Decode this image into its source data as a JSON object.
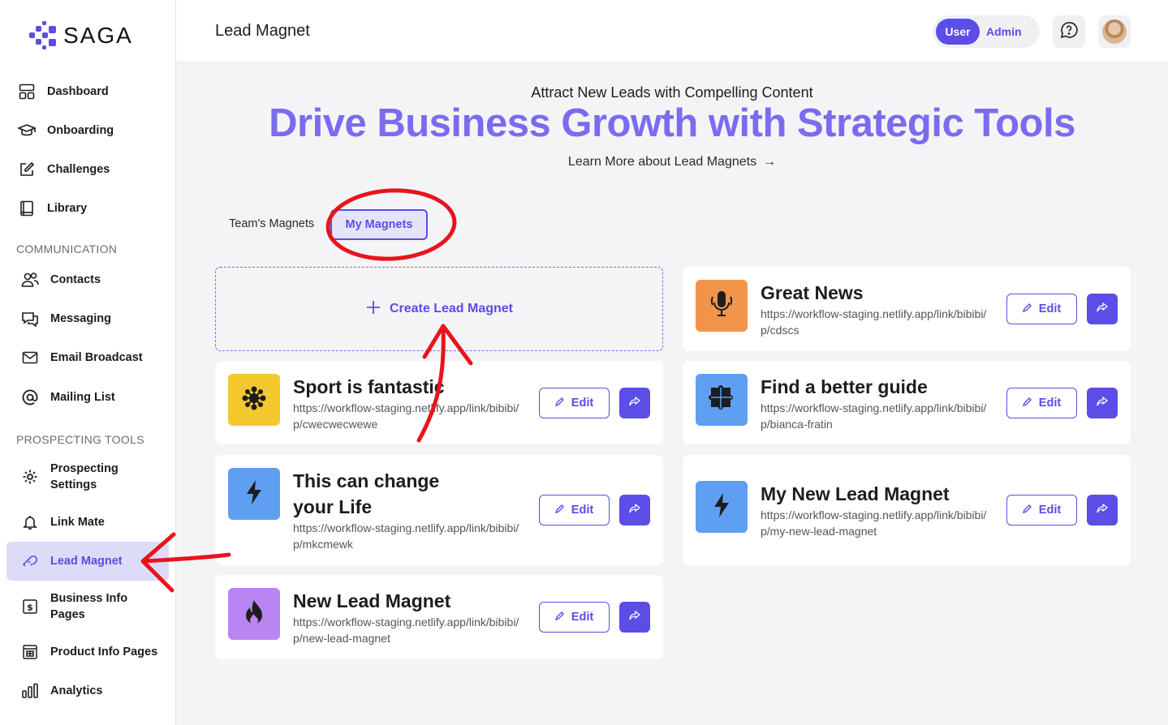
{
  "brand": {
    "name": "SAGA"
  },
  "sidebar": {
    "items": [
      {
        "label": "Dashboard",
        "icon": "dashboard-icon"
      },
      {
        "label": "Onboarding",
        "icon": "graduation-cap-icon"
      },
      {
        "label": "Challenges",
        "icon": "edit-square-icon"
      },
      {
        "label": "Library",
        "icon": "book-icon"
      }
    ],
    "communication_label": "COMMUNICATION",
    "communication": [
      {
        "label": "Contacts",
        "icon": "users-icon"
      },
      {
        "label": "Messaging",
        "icon": "chat-icon"
      },
      {
        "label": "Email Broadcast",
        "icon": "mail-icon"
      },
      {
        "label": "Mailing List",
        "icon": "at-icon"
      }
    ],
    "prospecting_label": "PROSPECTING TOOLS",
    "prospecting": [
      {
        "label": "Prospecting Settings",
        "icon": "gear-icon"
      },
      {
        "label": "Link Mate",
        "icon": "bell-icon"
      },
      {
        "label": "Lead Magnet",
        "icon": "magnet-icon",
        "active": true
      },
      {
        "label": "Business Info Pages",
        "icon": "dollar-doc-icon"
      },
      {
        "label": "Product Info Pages",
        "icon": "grid-doc-icon"
      },
      {
        "label": "Analytics",
        "icon": "bar-chart-icon"
      }
    ]
  },
  "header": {
    "title": "Lead Magnet",
    "role_user": "User",
    "role_admin": "Admin"
  },
  "hero": {
    "kicker": "Attract New Leads with Compelling Content",
    "title": "Drive Business Growth with Strategic Tools",
    "link": "Learn More about Lead Magnets",
    "link_arrow": "→"
  },
  "tabs": {
    "team": "Team's Magnets",
    "mine": "My Magnets"
  },
  "create_label": "Create Lead Magnet",
  "edit_label": "Edit",
  "magnets": [
    {
      "title": "Sport is fantastic",
      "url": "https://workflow-staging.netlify.app/link/bibibi/p/cwecwecwewe",
      "color": "#f2c82d",
      "icon": "network-icon"
    },
    {
      "title": "This can change your Life",
      "url": "https://workflow-staging.netlify.app/link/bibibi/p/mkcmewk",
      "color": "#5f9ff2",
      "icon": "lightning-icon"
    },
    {
      "title": "New Lead Magnet",
      "url": "https://workflow-staging.netlify.app/link/bibibi/p/new-lead-magnet",
      "color": "#b985f2",
      "icon": "fire-icon"
    },
    {
      "title": "Great News",
      "url": "https://workflow-staging.netlify.app/link/bibibi/p/cdscs",
      "color": "#f2944a",
      "icon": "microphone-icon"
    },
    {
      "title": "Find a better guide",
      "url": "https://workflow-staging.netlify.app/link/bibibi/p/bianca-fratin",
      "color": "#5f9ff2",
      "icon": "puzzle-icon"
    },
    {
      "title": "My New Lead Magnet",
      "url": "https://workflow-staging.netlify.app/link/bibibi/p/my-new-lead-magnet",
      "color": "#5f9ff2",
      "icon": "lightning-icon"
    }
  ],
  "colors": {
    "accent": "#5b4de6",
    "hero": "#7a6cf0",
    "annotation": "#e8141c"
  }
}
